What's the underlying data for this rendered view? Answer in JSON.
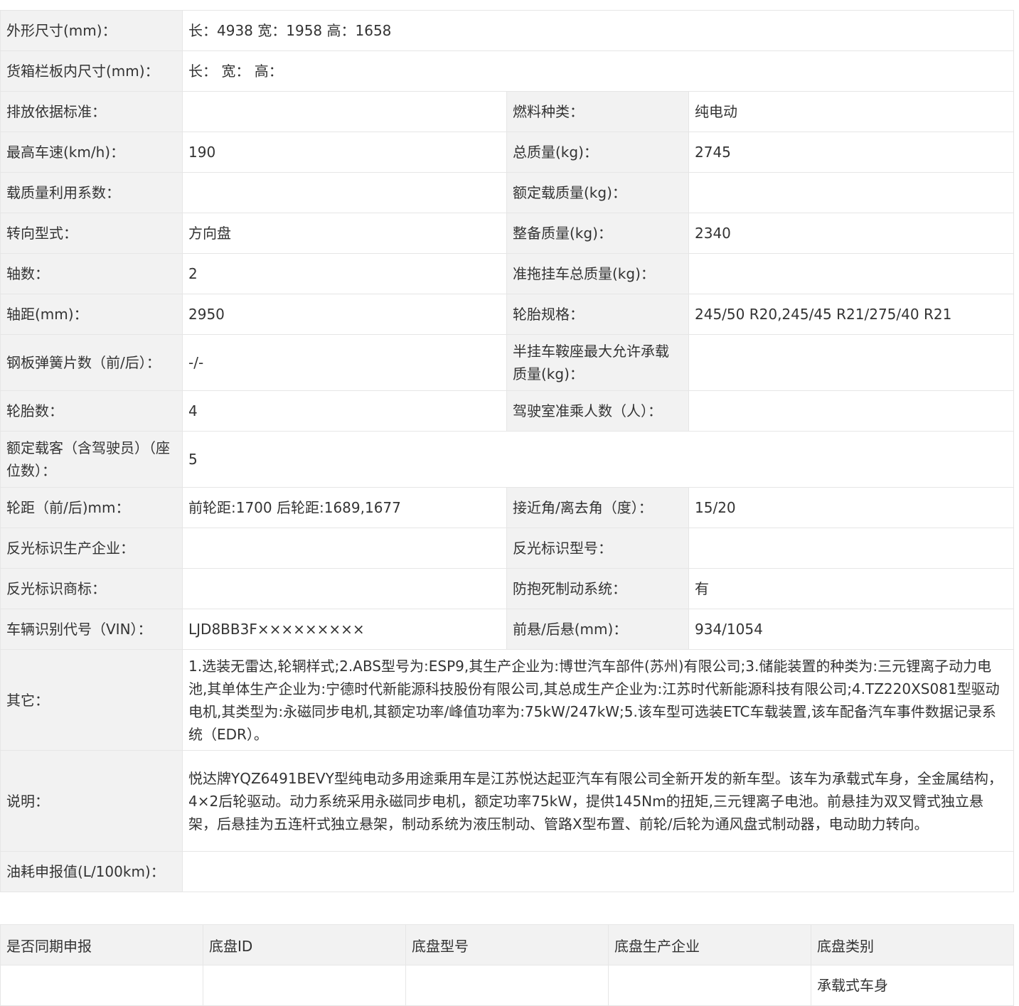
{
  "spec": {
    "dimensions": {
      "label": "外形尺寸(mm)：",
      "value": "长：4938 宽：1958 高：1658"
    },
    "cargo_box": {
      "label": "货箱栏板内尺寸(mm)：",
      "value": "长： 宽： 高："
    },
    "emission_std": {
      "label": "排放依据标准：",
      "value": ""
    },
    "fuel_type": {
      "label": "燃料种类：",
      "value": "纯电动"
    },
    "max_speed": {
      "label": "最高车速(km/h)：",
      "value": "190"
    },
    "total_mass": {
      "label": "总质量(kg)：",
      "value": "2745"
    },
    "load_factor": {
      "label": "载质量利用系数：",
      "value": ""
    },
    "rated_load": {
      "label": "额定载质量(kg)：",
      "value": ""
    },
    "steering": {
      "label": "转向型式：",
      "value": "方向盘"
    },
    "curb_mass": {
      "label": "整备质量(kg)：",
      "value": "2340"
    },
    "axles": {
      "label": "轴数：",
      "value": "2"
    },
    "trailer_mass": {
      "label": "准拖挂车总质量(kg)：",
      "value": ""
    },
    "wheelbase": {
      "label": "轴距(mm)：",
      "value": "2950"
    },
    "tire_spec": {
      "label": "轮胎规格：",
      "value": "245/50 R20,245/45 R21/275/40 R21"
    },
    "leaf_springs": {
      "label": "钢板弹簧片数（前/后）：",
      "value": "-/-"
    },
    "saddle_load": {
      "label": "半挂车鞍座最大允许承载质量(kg)：",
      "value": ""
    },
    "tire_count": {
      "label": "轮胎数：",
      "value": "4"
    },
    "cab_passengers": {
      "label": "驾驶室准乘人数（人）：",
      "value": ""
    },
    "seats": {
      "label": "额定载客（含驾驶员）（座位数）：",
      "value": "5"
    },
    "track": {
      "label": "轮距（前/后)mm：",
      "value": "前轮距:1700 后轮距:1689,1677"
    },
    "angles": {
      "label": "接近角/离去角（度）：",
      "value": "15/20"
    },
    "reflector_maker": {
      "label": "反光标识生产企业：",
      "value": ""
    },
    "reflector_model": {
      "label": "反光标识型号：",
      "value": ""
    },
    "reflector_brand": {
      "label": "反光标识商标：",
      "value": ""
    },
    "abs": {
      "label": "防抱死制动系统：",
      "value": "有"
    },
    "vin": {
      "label": "车辆识别代号（VIN）：",
      "value": "LJD8BB3F×××××××××"
    },
    "overhang": {
      "label": "前悬/后悬(mm)：",
      "value": "934/1054"
    },
    "other": {
      "label": "其它：",
      "value": "1.选装无雷达,轮辋样式;2.ABS型号为:ESP9,其生产企业为:博世汽车部件(苏州)有限公司;3.储能装置的种类为:三元锂离子动力电池,其单体生产企业为:宁德时代新能源科技股份有限公司,其总成生产企业为:江苏时代新能源科技有限公司;4.TZ220XS081型驱动电机,其类型为:永磁同步电机,其额定功率/峰值功率为:75kW/247kW;5.该车型可选装ETC车载装置,该车配备汽车事件数据记录系统（EDR）。"
    },
    "description": {
      "label": "说明：",
      "value": "悦达牌YQZ6491BEVY型纯电动多用途乘用车是江苏悦达起亚汽车有限公司全新开发的新车型。该车为承载式车身，全金属结构，4×2后轮驱动。动力系统采用永磁同步电机，额定功率75kW，提供145Nm的扭矩,三元锂离子电池。前悬挂为双叉臂式独立悬架，后悬挂为五连杆式独立悬架，制动系统为液压制动、管路X型布置、前轮/后轮为通风盘式制动器，电动助力转向。"
    },
    "fuel_consumption": {
      "label": "油耗申报值(L/100km)：",
      "value": ""
    }
  },
  "chassis": {
    "headers": [
      "是否同期申报",
      "底盘ID",
      "底盘型号",
      "底盘生产企业",
      "底盘类别"
    ],
    "row": [
      "",
      "",
      "",
      "",
      "承载式车身"
    ]
  }
}
